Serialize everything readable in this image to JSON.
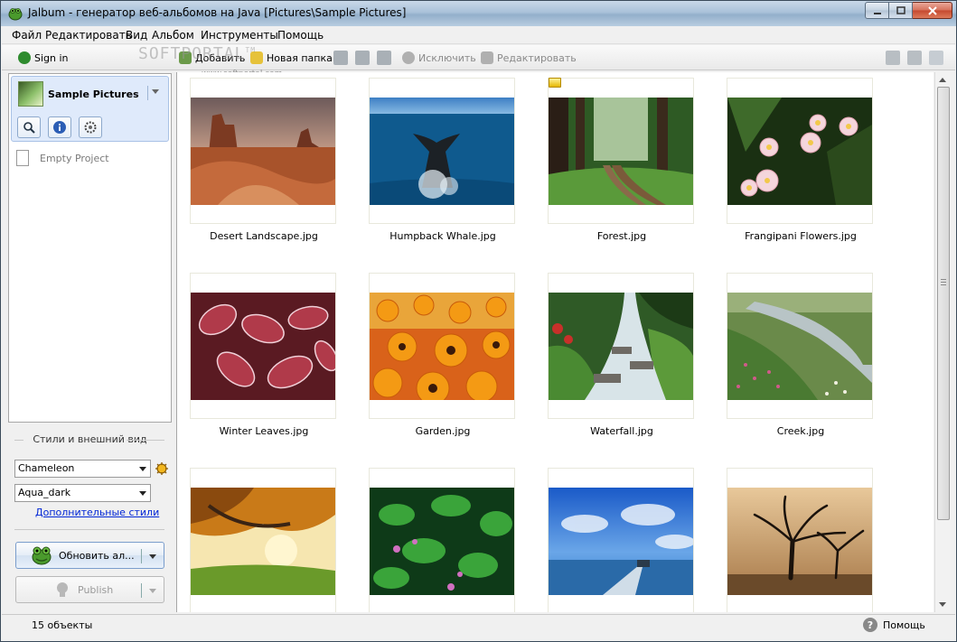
{
  "window": {
    "title": "Jalbum - генератор веб-альбомов на Java [Pictures\\Sample Pictures]"
  },
  "menu": [
    "Файл",
    "Редактировать",
    "Вид",
    "Альбом",
    "Инструменты",
    "Помощь"
  ],
  "toolbar": {
    "sign_in": "Sign in",
    "add": "Добавить",
    "new_folder": "Новая папка",
    "exclude": "Исключить",
    "edit": "Редактировать"
  },
  "watermark": {
    "text": "SOFTPORTAL",
    "tm": "TM",
    "url": "www.softportal.com"
  },
  "sidebar": {
    "project_title": "Sample Pictures",
    "empty_project": "Empty Project"
  },
  "styles": {
    "section_label": "Стили и внешний вид",
    "skin": "Chameleon",
    "style": "Aqua_dark",
    "more_styles_link": "Дополнительные стили",
    "update_button": "Обновить ал...",
    "publish_button": "Publish"
  },
  "thumbnails": [
    {
      "caption": "Desert Landscape.jpg"
    },
    {
      "caption": "Humpback Whale.jpg"
    },
    {
      "caption": "Forest.jpg"
    },
    {
      "caption": "Frangipani Flowers.jpg"
    },
    {
      "caption": "Winter Leaves.jpg"
    },
    {
      "caption": "Garden.jpg"
    },
    {
      "caption": "Waterfall.jpg"
    },
    {
      "caption": "Creek.jpg"
    },
    {
      "caption": ""
    },
    {
      "caption": ""
    },
    {
      "caption": ""
    },
    {
      "caption": ""
    }
  ],
  "status": {
    "count": "15 объекты",
    "help": "Помощь"
  },
  "colors": {
    "title_bar": "#a9c1d9",
    "selection_bg": "#dfeafb",
    "link": "#0026d6"
  }
}
